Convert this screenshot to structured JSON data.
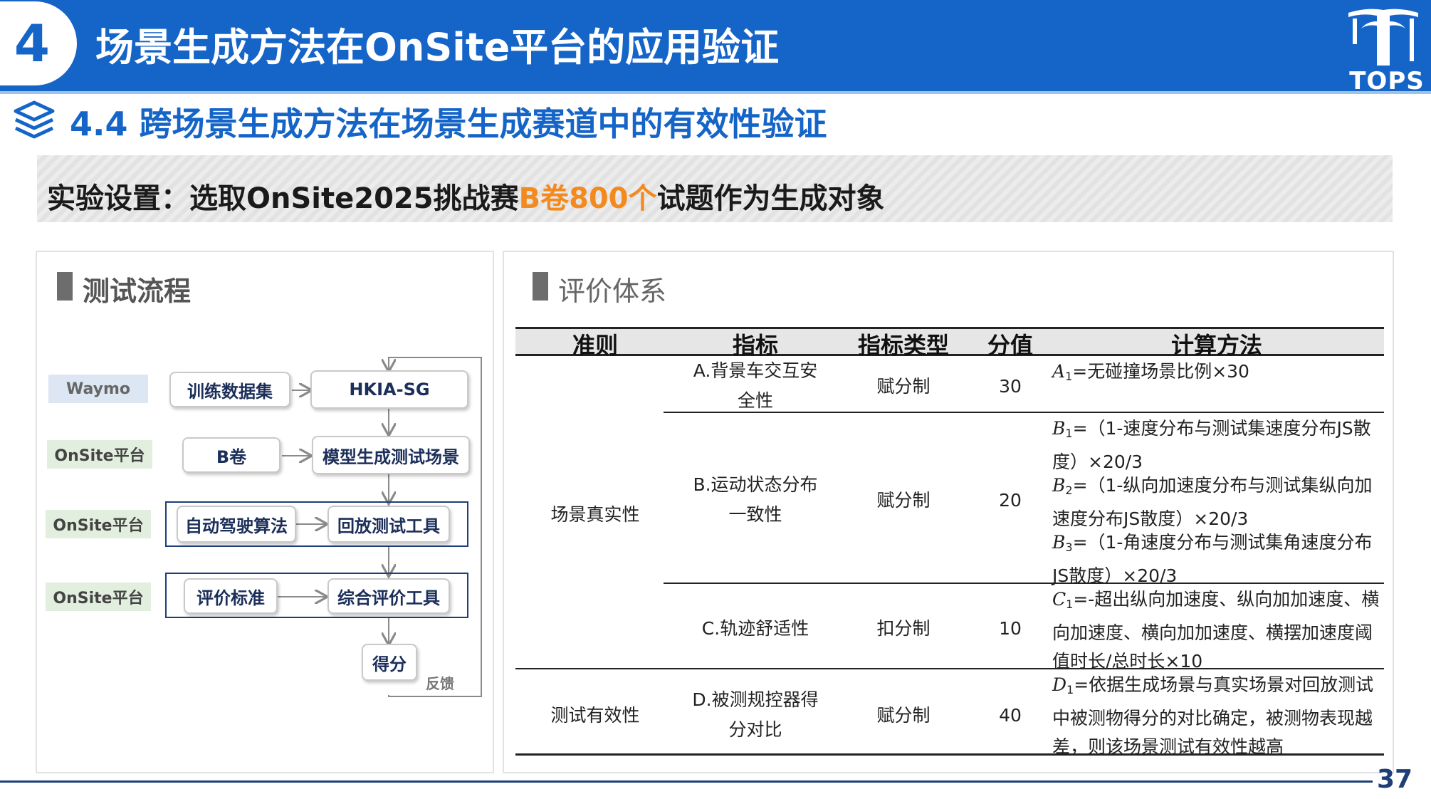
{
  "header": {
    "section_number": "4",
    "title": "场景生成方法在OnSite平台的应用验证",
    "logo_text": "TOPS"
  },
  "section": {
    "title": "4.4 跨场景生成方法在场景生成赛道中的有效性验证"
  },
  "setup": {
    "prefix": "实验设置：选取OnSite2025挑战赛",
    "highlight": "B卷800个",
    "suffix": "试题作为生成对象",
    "highlight_color": "#f28a1f"
  },
  "flow_panel": {
    "title": "测试流程",
    "sources": [
      "Waymo",
      "OnSite平台",
      "OnSite平台",
      "OnSite平台"
    ],
    "nodes": {
      "training_dataset": "训练数据集",
      "model": "HKIA-SG",
      "b_paper": "B卷",
      "model_generated": "模型生成测试场景",
      "ad_algorithm": "自动驾驶算法",
      "replay_tool": "回放测试工具",
      "criteria": "评价标准",
      "eval_tool": "综合评价工具",
      "score": "得分"
    },
    "feedback_label": "反馈"
  },
  "eval_panel": {
    "title": "评价体系",
    "headers": [
      "准则",
      "指标",
      "指标类型",
      "分值",
      "计算方法"
    ],
    "groups": [
      {
        "criterion": "场景真实性",
        "rows": [
          {
            "indicator": "A.背景车交互安全性",
            "type": "赋分制",
            "score": "30",
            "calc": [
              {
                "var": "A",
                "sub": "1",
                "text": "=无碰撞场景比例×30"
              }
            ]
          },
          {
            "indicator": "B.运动状态分布一致性",
            "type": "赋分制",
            "score": "20",
            "calc": [
              {
                "var": "B",
                "sub": "1",
                "text": "=（1-速度分布与测试集速度分布JS散度）×20/3"
              },
              {
                "var": "B",
                "sub": "2",
                "text": "=（1-纵向加速度分布与测试集纵向加速度分布JS散度）×20/3"
              },
              {
                "var": "B",
                "sub": "3",
                "text": "=（1-角速度分布与测试集角速度分布JS散度）×20/3"
              }
            ]
          },
          {
            "indicator": "C.轨迹舒适性",
            "type": "扣分制",
            "score": "10",
            "calc": [
              {
                "var": "C",
                "sub": "1",
                "text": "=-超出纵向加速度、纵向加加速度、横向加速度、横向加加速度、横摆加速度阈值时长/总时长×10"
              }
            ]
          }
        ]
      },
      {
        "criterion": "测试有效性",
        "rows": [
          {
            "indicator": "D.被测规控器得分对比",
            "type": "赋分制",
            "score": "40",
            "calc": [
              {
                "var": "D",
                "sub": "1",
                "text": "=依据生成场景与真实场景对回放测试中被测物得分的对比确定，被测物表现越差，则该场景测试有效性越高"
              }
            ]
          }
        ]
      }
    ]
  },
  "footer": {
    "page_number": "37"
  }
}
